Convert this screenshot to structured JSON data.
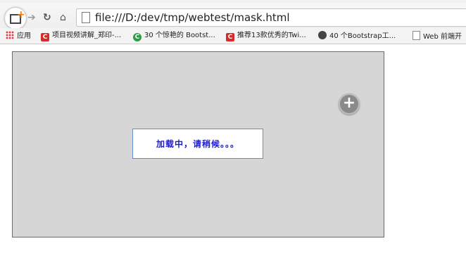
{
  "toolbar": {
    "url": "file:///D:/dev/tmp/webtest/mask.html",
    "icons": [
      "new-tab-icon",
      "forward-icon",
      "reload-icon",
      "home-icon",
      "page-icon"
    ]
  },
  "bookmarks": [
    {
      "label": "应用",
      "icon": "apps-icon"
    },
    {
      "label": "项目视频讲解_郑印-...",
      "icon": "red-c-icon"
    },
    {
      "label": "30 个惊艳的 Bootst...",
      "icon": "green-c-icon"
    },
    {
      "label": "推荐13款优秀的Twi...",
      "icon": "red-c-icon"
    },
    {
      "label": "40 个Bootstrap工...",
      "icon": "github-icon"
    },
    {
      "label": "Web 前端开",
      "icon": "page-icon"
    }
  ],
  "page": {
    "loading_text": "加载中，请稍候。。。",
    "zoom_symbol": "+"
  },
  "colors": {
    "mask_bg": "#d6d6d6",
    "mask_border": "#e23b3b",
    "loading_text": "#1c1cd6",
    "loading_border": "#5b8fd6"
  }
}
